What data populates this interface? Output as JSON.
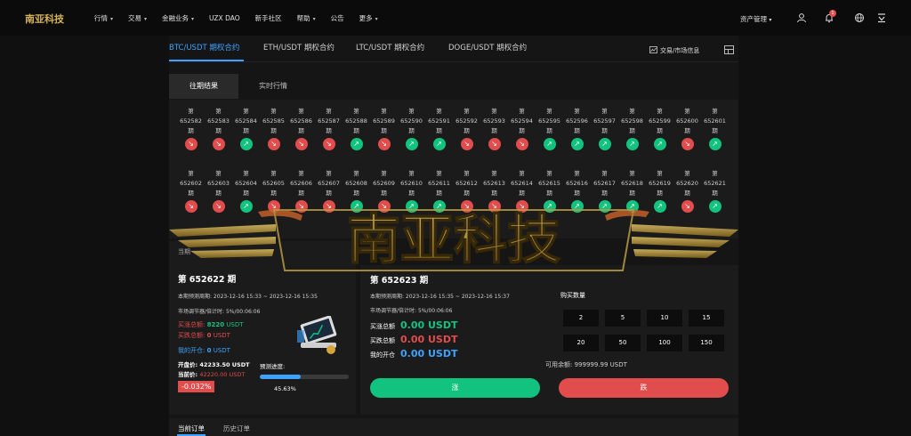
{
  "nav": {
    "logo_text": "南亚科技",
    "items": [
      {
        "label": "行情",
        "has_dropdown": true
      },
      {
        "label": "交易",
        "has_dropdown": true
      },
      {
        "label": "金融业务",
        "has_dropdown": true
      },
      {
        "label": "UZX DAO",
        "has_dropdown": false
      },
      {
        "label": "新手社区",
        "has_dropdown": false
      },
      {
        "label": "帮助",
        "has_dropdown": true
      },
      {
        "label": "公告",
        "has_dropdown": false
      },
      {
        "label": "更多",
        "has_dropdown": true
      }
    ],
    "asset_mgmt": "资产管理",
    "notification_count": "1",
    "icons": [
      "user-icon",
      "bell-icon",
      "globe-icon",
      "download-icon"
    ]
  },
  "contract_tabs": [
    {
      "label": "BTC/USDT 期权合约",
      "active": true
    },
    {
      "label": "ETH/USDT 期权合约",
      "active": false
    },
    {
      "label": "LTC/USDT 期权合约",
      "active": false
    },
    {
      "label": "DOGE/USDT 期权合约",
      "active": false
    }
  ],
  "market_info_label": "交易/市场信息",
  "sub_tabs": [
    {
      "label": "往期结果",
      "active": true
    },
    {
      "label": "实时行情",
      "active": false
    }
  ],
  "history": {
    "prefix": "第",
    "suffix": "期",
    "row1": [
      {
        "period": "652582",
        "dir": "down"
      },
      {
        "period": "652583",
        "dir": "down"
      },
      {
        "period": "652584",
        "dir": "up"
      },
      {
        "period": "652585",
        "dir": "down"
      },
      {
        "period": "652586",
        "dir": "down"
      },
      {
        "period": "652587",
        "dir": "down"
      },
      {
        "period": "652588",
        "dir": "up"
      },
      {
        "period": "652589",
        "dir": "down"
      },
      {
        "period": "652590",
        "dir": "up"
      },
      {
        "period": "652591",
        "dir": "up"
      },
      {
        "period": "652592",
        "dir": "down"
      },
      {
        "period": "652593",
        "dir": "down"
      },
      {
        "period": "652594",
        "dir": "down"
      },
      {
        "period": "652595",
        "dir": "up"
      },
      {
        "period": "652596",
        "dir": "up"
      },
      {
        "period": "652597",
        "dir": "up"
      },
      {
        "period": "652598",
        "dir": "up"
      },
      {
        "period": "652599",
        "dir": "up"
      },
      {
        "period": "652600",
        "dir": "down"
      },
      {
        "period": "652601",
        "dir": "up"
      }
    ],
    "row2": [
      {
        "period": "652602",
        "dir": "down"
      },
      {
        "period": "652603",
        "dir": "down"
      },
      {
        "period": "652604",
        "dir": "up"
      },
      {
        "period": "652605",
        "dir": "down"
      },
      {
        "period": "652606",
        "dir": "down"
      },
      {
        "period": "652607",
        "dir": "down"
      },
      {
        "period": "652608",
        "dir": "up"
      },
      {
        "period": "652609",
        "dir": "down"
      },
      {
        "period": "652610",
        "dir": "up"
      },
      {
        "period": "652611",
        "dir": "up"
      },
      {
        "period": "652612",
        "dir": "down"
      },
      {
        "period": "652613",
        "dir": "down"
      },
      {
        "period": "652614",
        "dir": "down"
      },
      {
        "period": "652615",
        "dir": "up"
      },
      {
        "period": "652616",
        "dir": "up"
      },
      {
        "period": "652617",
        "dir": "up"
      },
      {
        "period": "652618",
        "dir": "up"
      },
      {
        "period": "652619",
        "dir": "up"
      },
      {
        "period": "652620",
        "dir": "down"
      },
      {
        "period": "652621",
        "dir": "up"
      }
    ]
  },
  "current": {
    "label": "当期",
    "title": "第 652622 期",
    "period_range": "本期预测周期: 2023-12-16 15:33 ~ 2023-12-16 15:35",
    "adjust_info": "市场调节器/倍计时: 5%/00:06:06",
    "buy_up": {
      "label": "买涨总额:",
      "value": "8220",
      "unit": "USDT"
    },
    "buy_down": {
      "label": "买跌总额:",
      "value": "0",
      "unit": "USDT"
    },
    "my_open": {
      "label": "我的开仓:",
      "value": "0",
      "unit": "USDT"
    },
    "open_price": {
      "label": "开盘价:",
      "value": "42233.50 USDT"
    },
    "current_price": {
      "label": "当前价:",
      "value": "42220.00 USDT"
    },
    "change_pct": "-0.032%",
    "progress_label": "预测进度:",
    "progress_value": 45.63,
    "progress_text": "45.63%"
  },
  "trade": {
    "title": "第 652623 期",
    "period_range": "本期预测周期: 2023-12-16 15:35 ~ 2023-12-16 15:37",
    "adjust_info": "市场调节器/倍计时: 5%/00:06:06",
    "buy_up": {
      "label": "买涨总额",
      "value": "0.00 USDT"
    },
    "buy_down": {
      "label": "买跌总额",
      "value": "0.00 USDT"
    },
    "my_open": {
      "label": "我的开仓",
      "value": "0.00 USDT"
    },
    "qty_label": "购买数量",
    "quantities": [
      "2",
      "5",
      "10",
      "15",
      "20",
      "50",
      "100",
      "150"
    ],
    "available": "可用余额: 999999.99 USDT",
    "rise_label": "涨",
    "fall_label": "跌"
  },
  "order_tabs": [
    {
      "label": "当前订单",
      "active": true
    },
    {
      "label": "历史订单",
      "active": false
    }
  ],
  "watermark_text": "南亚科技",
  "colors": {
    "accent": "#3ea3ff",
    "up": "#11c37f",
    "down": "#e14c4c",
    "watermark_gold": "#b89a42"
  }
}
